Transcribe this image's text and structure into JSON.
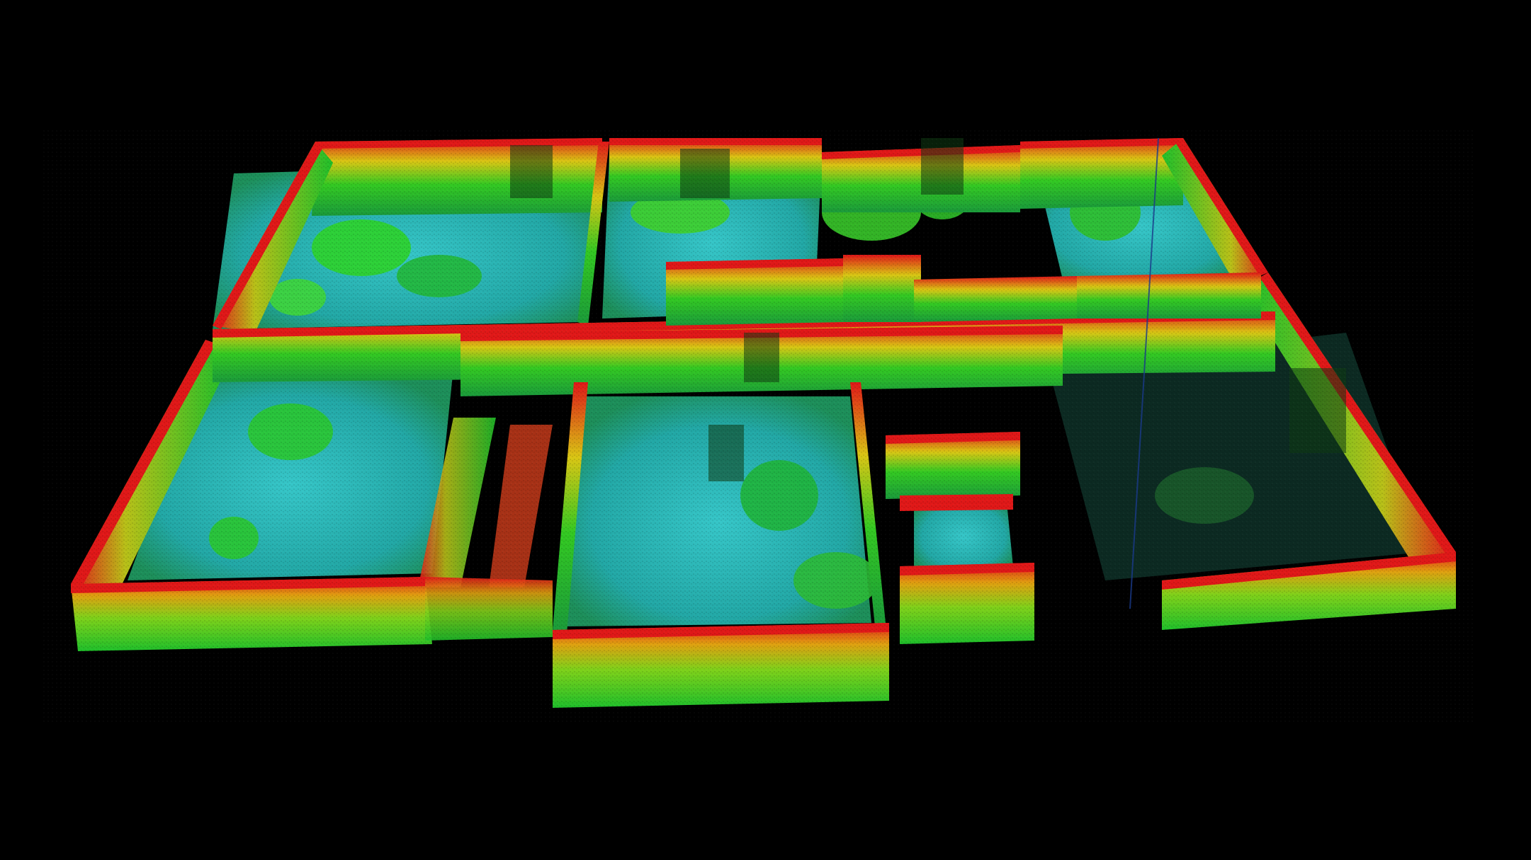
{
  "scene": {
    "background_color": "#000000",
    "colormap": {
      "low": "#2fc4c8",
      "mid_low": "#1fbf2a",
      "mid": "#7fd11a",
      "mid_high": "#e0a010",
      "high": "#e01818"
    },
    "icons": [
      "point-cloud-floorplan"
    ]
  }
}
